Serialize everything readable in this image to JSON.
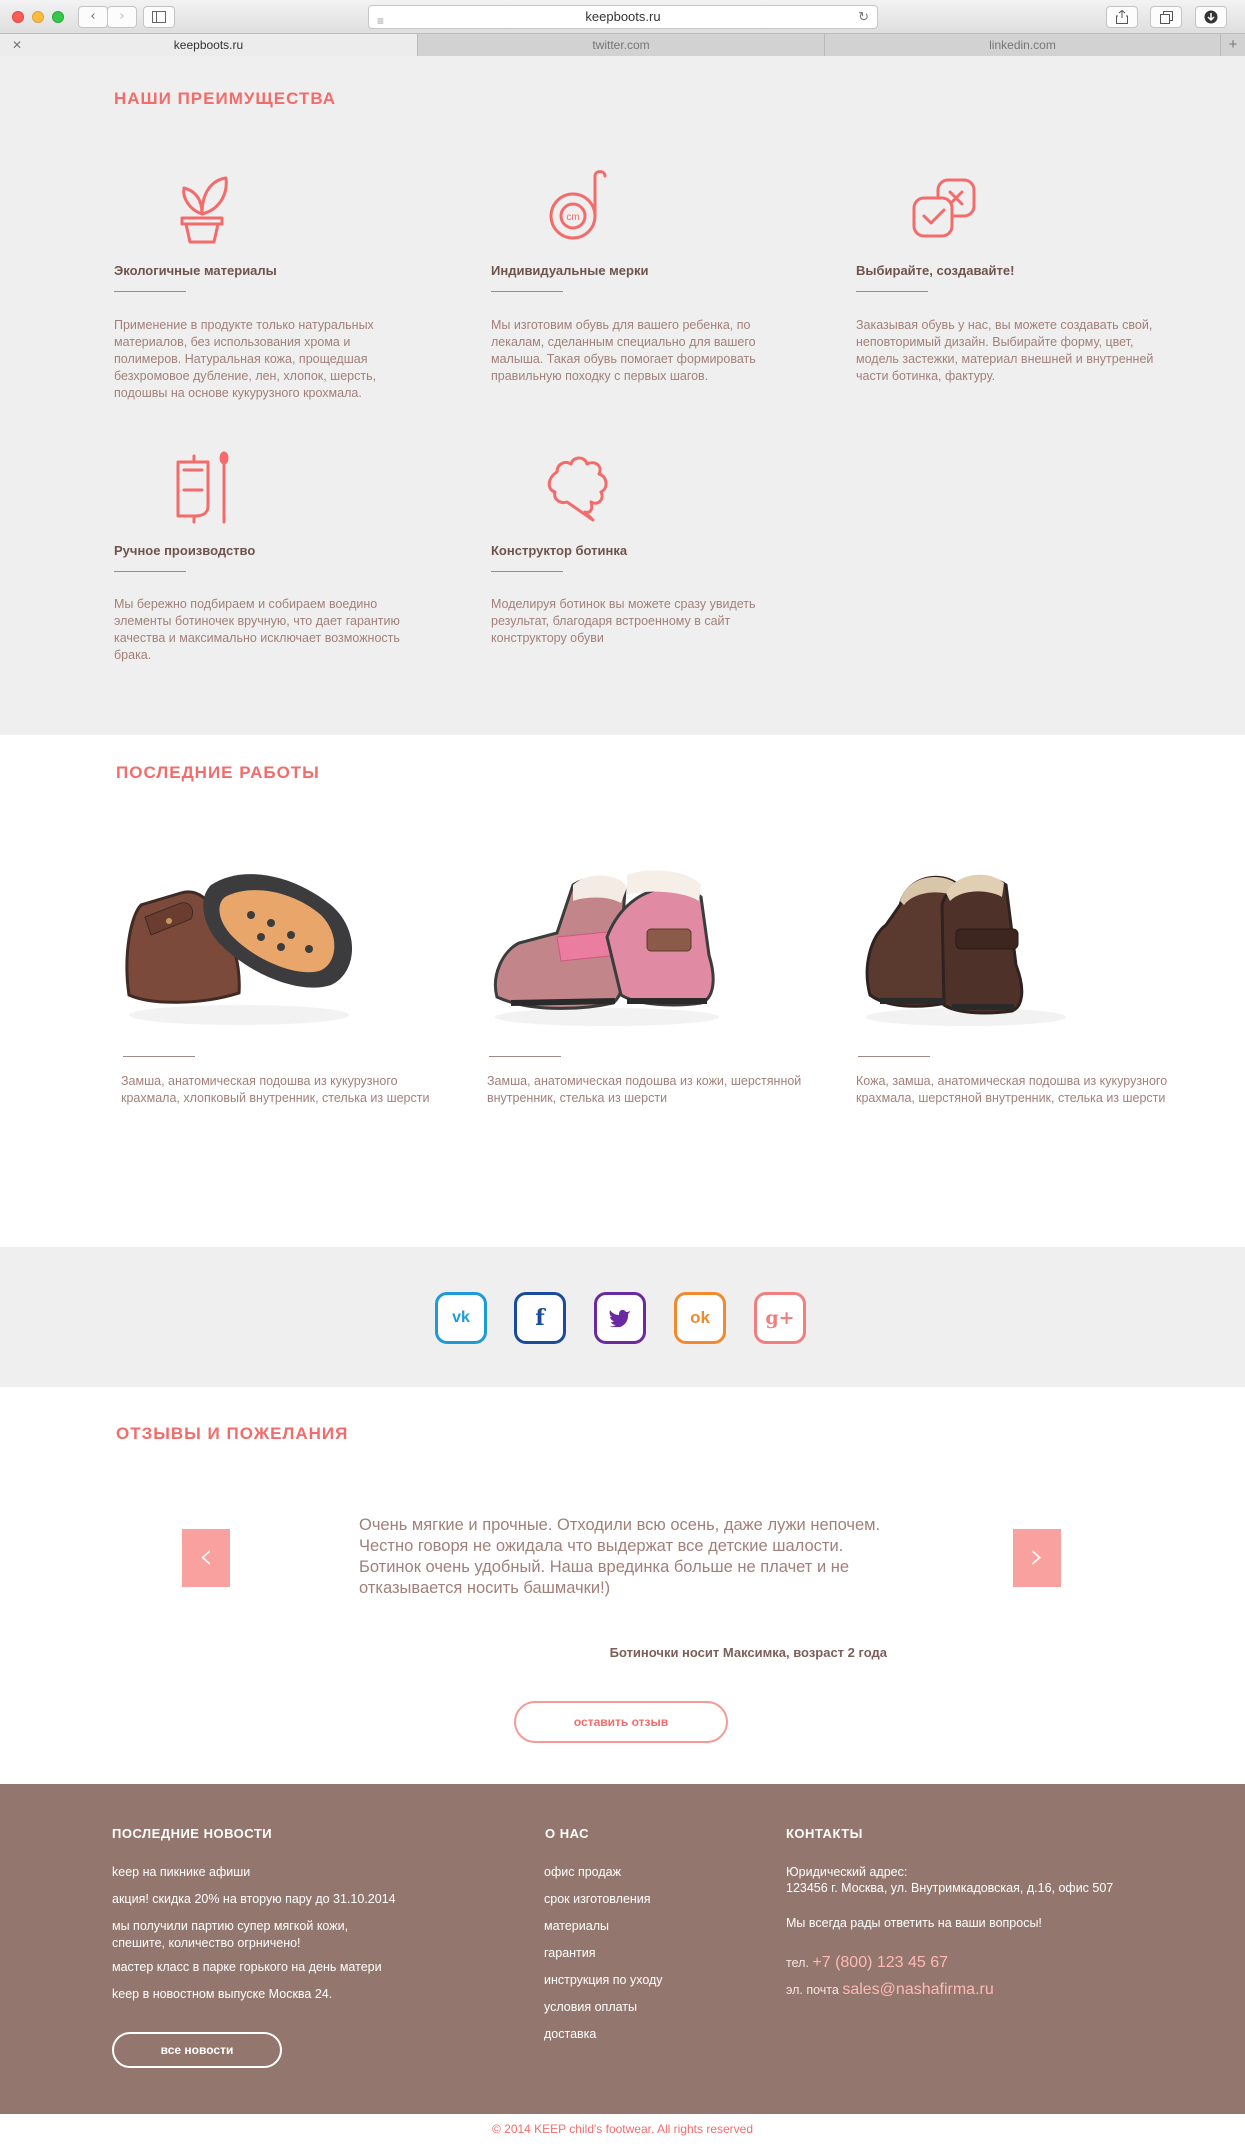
{
  "browser": {
    "url": "keepboots.ru",
    "tabs": [
      "keepboots.ru",
      "twitter.com",
      "linkedin.com"
    ],
    "back_icon": "chevron-left-icon",
    "forward_icon": "chevron-right-icon"
  },
  "advantages": {
    "title": "НАШИ ПРЕИМУЩЕСТВА",
    "items": [
      {
        "icon": "plant-pot-icon",
        "title": "Экологичные материалы",
        "text": "Применение в продукте только натуральных материалов, без использования хрома и полимеров. Натуральная кожа, прощедшая безхромовое дубление, лен, хлопок, шерсть, подошвы на основе кукурузного крохмала."
      },
      {
        "icon": "tape-measure-icon",
        "title": "Индивидуальные мерки",
        "text": "Мы изготовим обувь для вашего ребенка, по лекалам, сделанным специально для вашего малыша. Такая обувь помогает формировать правильную походку с первых шагов.",
        "badge": "cm"
      },
      {
        "icon": "choose-create-icon",
        "title": "Выбирайте, создавайте!",
        "text": "Заказывая обувь у нас, вы можете создавать свой, неповторимый дизайн. Выбирайте форму, цвет, модель застежки, материал внешней и внутренней части ботинка, фактуру."
      },
      {
        "icon": "thread-needle-icon",
        "title": "Ручное производство",
        "text": "Мы бережно подбираем и собираем воедино элементы ботиночек вручную, что дает гарантию качества и максимально исключает возможность брака."
      },
      {
        "icon": "puzzle-constructor-icon",
        "title": "Конструктор ботинка",
        "text": "Моделируя ботинок вы можете сразу увидеть результат, благодаря встроенному в сайт конструктору обуви"
      }
    ]
  },
  "works": {
    "title": "ПОСЛЕДНИЕ РАБОТЫ",
    "items": [
      {
        "text": "Замша, анатомическая подошва из кукурузного крахмала, хлопковый внутренник, стелька из шерсти"
      },
      {
        "text": "Замша, анатомическая подошва из кожи, шерстянной внутренник, стелька из шерсти"
      },
      {
        "text": "Кожа, замша, анатомическая подошва из кукурузного крахмала, шерстяной внутренник, стелька из шерсти"
      }
    ]
  },
  "social": [
    {
      "name": "vk-icon",
      "glyph": "vk",
      "color": "#1e9bd6"
    },
    {
      "name": "facebook-icon",
      "glyph": "f",
      "color": "#1a4b9c"
    },
    {
      "name": "twitter-icon",
      "glyph": "t",
      "color": "#6a2aa0"
    },
    {
      "name": "odnoklassniki-icon",
      "glyph": "ok",
      "color": "#f08a2c"
    },
    {
      "name": "google-plus-icon",
      "glyph": "g+",
      "color": "#f17f7f"
    }
  ],
  "reviews": {
    "title": "ОТЗЫВЫ И ПОЖЕЛАНИЯ",
    "quote": "Очень мягкие и прочные. Отходили всю осень, даже лужи непочем. Честно говоря не ожидала что выдержат все детские шалости. Ботинок очень удобный. Наша врединка больше не плачет и не отказывается носить башмачки!)",
    "author": "Ботиночки носит Максимка, возраст 2 года",
    "button": "оставить отзыв",
    "prev_icon": "chevron-left-icon",
    "next_icon": "chevron-right-icon"
  },
  "footer": {
    "news": {
      "title": "ПОСЛЕДНИЕ НОВОСТИ",
      "items": [
        "keep на пикнике афиши",
        "акция! скидка 20% на вторую пару до 31.10.2014",
        "мы получили партию супер мягкой кожи, спешите, количество огрничено!",
        "мастер класс в парке горького на день матери",
        "keep в новостном выпуске Москва 24."
      ],
      "button": "все новости"
    },
    "about": {
      "title": "О НАС",
      "items": [
        "офис продаж",
        "срок изготовления",
        "материалы",
        "гарантия",
        "инструкция по уходу",
        "условия оплаты",
        "доставка"
      ]
    },
    "contacts": {
      "title": "КОНТАКТЫ",
      "address_label": "Юридический адрес:",
      "address": "123456 г. Москва, ул. Внутримкадовская, д.16, офис 507",
      "note": "Мы всегда рады ответить на ваши вопросы!",
      "phone_label": "тел.",
      "phone": "+7 (800) 123 45 67",
      "email_label": "эл. почта",
      "email": "sales@nashafirma.ru"
    },
    "copyright": "© 2014 KEEP child's footwear. All rights reserved"
  }
}
